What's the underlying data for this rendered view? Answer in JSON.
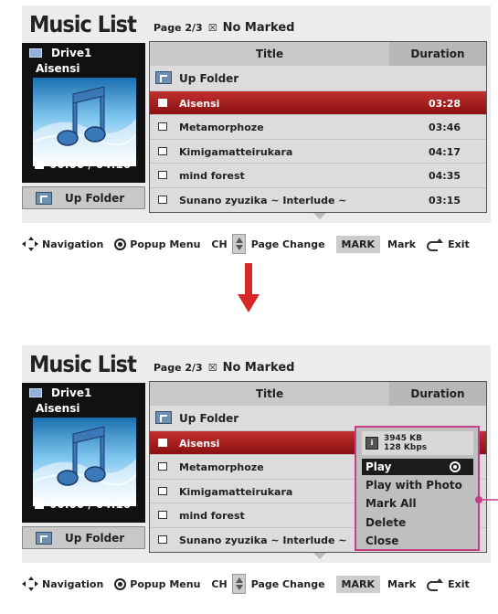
{
  "arrow_color": "#d62828",
  "callout_color": "#c43f88",
  "panels": [
    {
      "title": "Music List",
      "page_info": "Page 2/3",
      "marked": "No Marked",
      "drive": "Drive1",
      "track": "Aisensi",
      "time": "00:00 / 04:16",
      "up_folder_button": "Up Folder",
      "header_title": "Title",
      "header_duration": "Duration",
      "folder_row": "Up Folder",
      "rows": [
        {
          "title": "Aisensi",
          "duration": "03:28"
        },
        {
          "title": "Metamorphoze",
          "duration": "03:46"
        },
        {
          "title": "Kimigamatteirukara",
          "duration": "04:17"
        },
        {
          "title": "mind forest",
          "duration": "04:35"
        },
        {
          "title": "Sunano zyuzika ~ Interlude ~",
          "duration": "03:15"
        }
      ]
    },
    {
      "title": "Music List",
      "page_info": "Page 2/3",
      "marked": "No Marked",
      "drive": "Drive1",
      "track": "Aisensi",
      "time": "00:00 / 04:16",
      "up_folder_button": "Up Folder",
      "header_title": "Title",
      "header_duration": "Duration",
      "folder_row": "Up Folder",
      "rows": [
        {
          "title": "Aisensi",
          "duration": ""
        },
        {
          "title": "Metamorphoze",
          "duration": ""
        },
        {
          "title": "Kimigamatteirukara",
          "duration": ""
        },
        {
          "title": "mind forest",
          "duration": ""
        },
        {
          "title": "Sunano zyuzika ~ Interlude ~",
          "duration": ""
        }
      ]
    }
  ],
  "footer": {
    "navigation": "Navigation",
    "popup_menu": "Popup Menu",
    "ch": "CH",
    "page_change": "Page Change",
    "mark_button": "MARK",
    "mark": "Mark",
    "exit": "Exit"
  },
  "popup": {
    "size_kb": "3945 KB",
    "bitrate": "128 Kbps",
    "options": [
      "Play",
      "Play with Photo",
      "Mark All",
      "Delete",
      "Close"
    ]
  }
}
